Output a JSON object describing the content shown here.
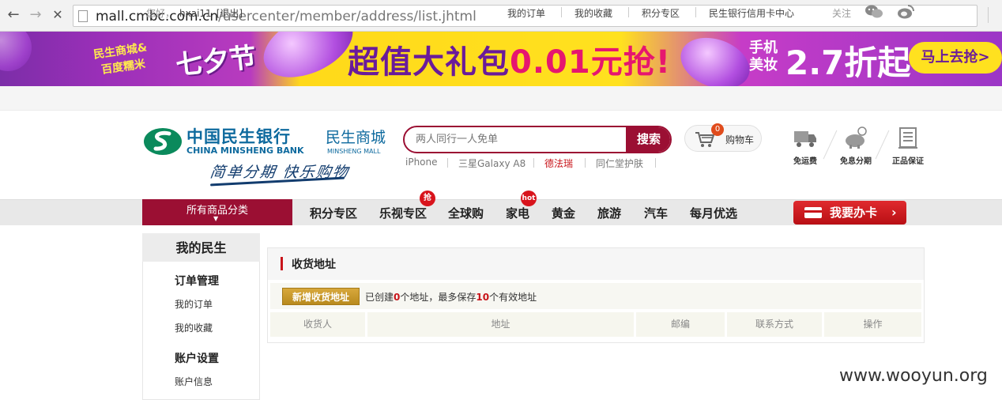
{
  "browser": {
    "back": "←",
    "forward": "→",
    "stop": "✕",
    "url_host": "mall.cmbc.com.cn",
    "url_path": "/usercenter/member/address/list.jhtml"
  },
  "banner": {
    "left_line1": "民生商城&",
    "left_line2": "百度糯米",
    "left_big": "七夕节",
    "main_prefix": "超值大礼包",
    "main_price": "0.01",
    "main_suffix": "元抢!",
    "right_small": "手机美妆",
    "right_big": "2.7折起",
    "cta": "马上去抢>"
  },
  "topbar": {
    "greeting": "您好，",
    "username": "hxai11",
    "logout": "[退出]",
    "links": [
      "我的订单",
      "我的收藏",
      "积分专区",
      "民生银行信用卡中心"
    ],
    "follow": "关注"
  },
  "header": {
    "logo_cn": "中国民生银行",
    "logo_en": "CHINA MINSHENG BANK",
    "mall_cn": "民生商城",
    "mall_en": "MINSHENG MALL",
    "slogan": "简单分期 快乐购物",
    "search_placeholder": "两人同行一人免单",
    "search_button": "搜索",
    "hot_keywords": [
      "iPhone",
      "三星Galaxy A8",
      "德法瑞",
      "同仁堂护肤"
    ],
    "cart_count": "0",
    "cart_label": "购物车",
    "services": [
      "免运费",
      "免息分期",
      "正品保证"
    ]
  },
  "nav": {
    "all_categories": "所有商品分类",
    "items": [
      "积分专区",
      "乐视专区",
      "全球购",
      "家电",
      "黄金",
      "旅游",
      "汽车",
      "每月优选"
    ],
    "badge_grab": "抢",
    "badge_hot": "hot",
    "apply_card": "我要办卡"
  },
  "sidebar": {
    "title": "我的民生",
    "group1": "订单管理",
    "group1_links": [
      "我的订单",
      "我的收藏"
    ],
    "group2": "账户设置",
    "group2_links": [
      "账户信息"
    ]
  },
  "content": {
    "title": "收货地址",
    "add_button": "新增收货地址",
    "info_prefix": "已创建",
    "created_count": "0",
    "info_mid": "个地址，最多保存",
    "max_count": "10",
    "info_suffix": "个有效地址",
    "columns": [
      "收货人",
      "地址",
      "邮编",
      "联系方式",
      "操作"
    ]
  },
  "watermark": "www.wooyun.org",
  "colors": {
    "brand_red": "#9b0f33",
    "brand_blue": "#0e6a9e",
    "gold_button": "#c99a2c"
  }
}
